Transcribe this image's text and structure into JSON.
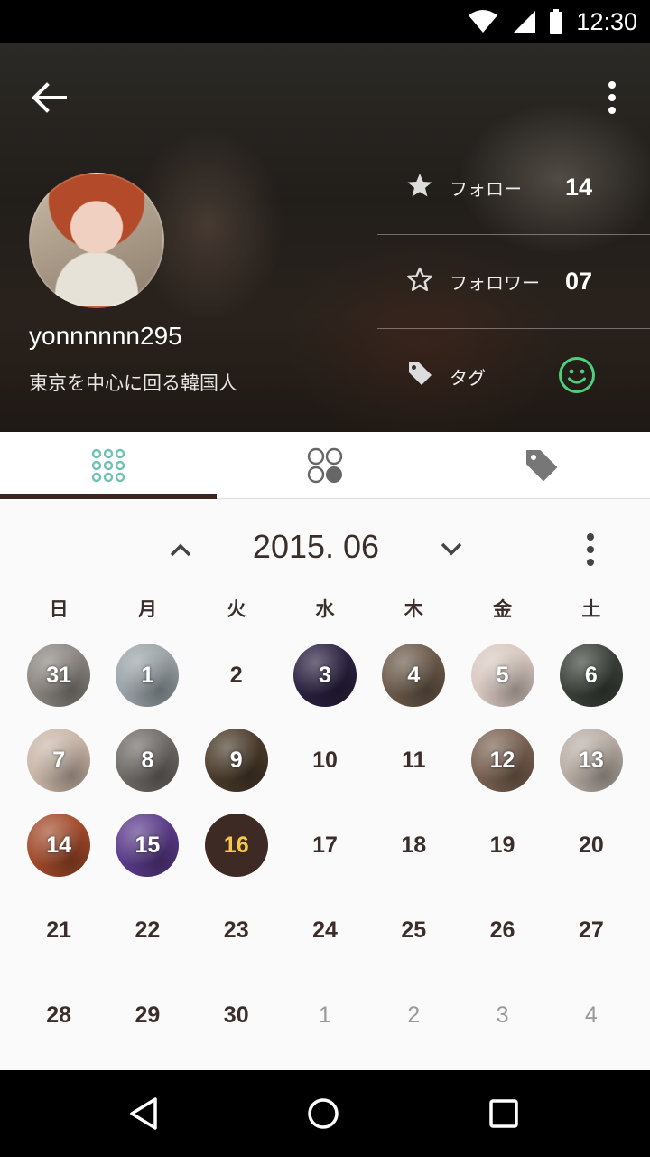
{
  "status_bar": {
    "time": "12:30",
    "icons": [
      "wifi-icon",
      "signal-icon",
      "battery-icon"
    ]
  },
  "profile": {
    "username": "yonnnnnn295",
    "bio": "東京を中心に回る韓国人",
    "stats": [
      {
        "icon": "star-filled-icon",
        "label": "フォロー",
        "value": "14"
      },
      {
        "icon": "star-outline-icon",
        "label": "フォロワー",
        "value": "07"
      },
      {
        "icon": "tag-icon",
        "label": "タグ",
        "value": ""
      }
    ]
  },
  "tabs": [
    {
      "icon": "dots-grid-icon",
      "active": true
    },
    {
      "icon": "circles-grid-icon",
      "active": false
    },
    {
      "icon": "tag-icon",
      "active": false
    }
  ],
  "calendar": {
    "month_title": "2015. 06",
    "weekdays": [
      "日",
      "月",
      "火",
      "水",
      "木",
      "金",
      "土"
    ],
    "days": [
      {
        "label": "31",
        "photo": true,
        "other_month": false,
        "color": "#8a8580"
      },
      {
        "label": "1",
        "photo": true,
        "other_month": false,
        "color": "#9aa3a8"
      },
      {
        "label": "2",
        "photo": false,
        "other_month": false
      },
      {
        "label": "3",
        "photo": true,
        "other_month": false,
        "color": "#2a2040"
      },
      {
        "label": "4",
        "photo": true,
        "other_month": false,
        "color": "#6b5a4a"
      },
      {
        "label": "5",
        "photo": true,
        "other_month": false,
        "color": "#d8c8c0"
      },
      {
        "label": "6",
        "photo": true,
        "other_month": false,
        "color": "#3a4038"
      },
      {
        "label": "7",
        "photo": true,
        "other_month": false,
        "color": "#c9b6a8"
      },
      {
        "label": "8",
        "photo": true,
        "other_month": false,
        "color": "#6e6a66"
      },
      {
        "label": "9",
        "photo": true,
        "other_month": false,
        "color": "#4a3a2a"
      },
      {
        "label": "10",
        "photo": false,
        "other_month": false
      },
      {
        "label": "11",
        "photo": false,
        "other_month": false
      },
      {
        "label": "12",
        "photo": true,
        "other_month": false,
        "color": "#7a6252"
      },
      {
        "label": "13",
        "photo": true,
        "other_month": false,
        "color": "#b8ada4"
      },
      {
        "label": "14",
        "photo": true,
        "other_month": false,
        "color": "#a24a2a"
      },
      {
        "label": "15",
        "photo": true,
        "other_month": false,
        "color": "#5a3a8a"
      },
      {
        "label": "16",
        "photo": false,
        "other_month": false,
        "today": true
      },
      {
        "label": "17",
        "photo": false,
        "other_month": false
      },
      {
        "label": "18",
        "photo": false,
        "other_month": false
      },
      {
        "label": "19",
        "photo": false,
        "other_month": false
      },
      {
        "label": "20",
        "photo": false,
        "other_month": false
      },
      {
        "label": "21",
        "photo": false,
        "other_month": false
      },
      {
        "label": "22",
        "photo": false,
        "other_month": false
      },
      {
        "label": "23",
        "photo": false,
        "other_month": false
      },
      {
        "label": "24",
        "photo": false,
        "other_month": false
      },
      {
        "label": "25",
        "photo": false,
        "other_month": false
      },
      {
        "label": "26",
        "photo": false,
        "other_month": false
      },
      {
        "label": "27",
        "photo": false,
        "other_month": false
      },
      {
        "label": "28",
        "photo": false,
        "other_month": false
      },
      {
        "label": "29",
        "photo": false,
        "other_month": false
      },
      {
        "label": "30",
        "photo": false,
        "other_month": false
      },
      {
        "label": "1",
        "photo": false,
        "other_month": true
      },
      {
        "label": "2",
        "photo": false,
        "other_month": true
      },
      {
        "label": "3",
        "photo": false,
        "other_month": true
      },
      {
        "label": "4",
        "photo": false,
        "other_month": true
      }
    ]
  },
  "colors": {
    "accent_dark": "#3b2520",
    "today_text": "#f6c84a",
    "tab_active_icon": "#6fc1b4",
    "smile": "#4cd07a"
  },
  "nav": [
    "back-triangle-icon",
    "home-circle-icon",
    "recents-square-icon"
  ]
}
